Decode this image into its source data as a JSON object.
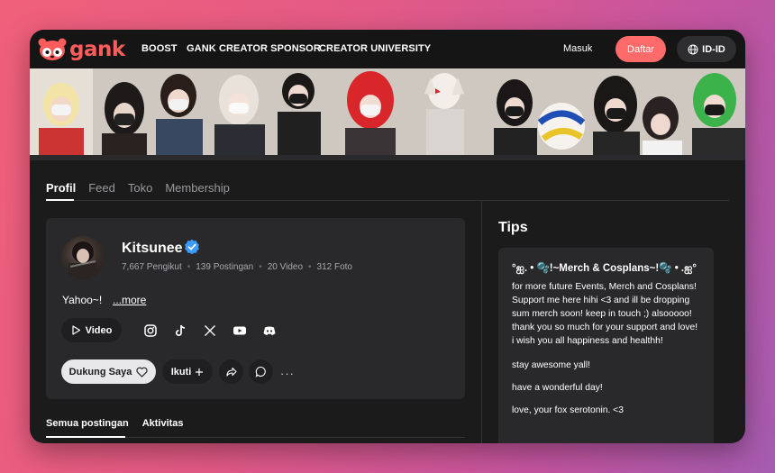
{
  "nav": {
    "logo_text": "gank",
    "links": [
      "BOOST",
      "GANK CREATOR SPONSOR",
      "CREATOR UNIVERSITY"
    ],
    "login_label": "Masuk",
    "signup_label": "Daftar",
    "lang_label": "ID-ID"
  },
  "tabs": [
    {
      "label": "Profil",
      "active": true
    },
    {
      "label": "Feed",
      "active": false
    },
    {
      "label": "Toko",
      "active": false
    },
    {
      "label": "Membership",
      "active": false
    }
  ],
  "profile": {
    "name": "Kitsunee",
    "verified": true,
    "stats": [
      "7,667 Pengikut",
      "139 Postingan",
      "20 Video",
      "312 Foto"
    ],
    "bio": "Yahoo~!",
    "more_label": "...more",
    "video_label": "Video",
    "socials": [
      "instagram-icon",
      "tiktok-icon",
      "x-icon",
      "youtube-icon",
      "discord-icon"
    ],
    "support_label": "Dukung Saya",
    "follow_label": "Ikuti",
    "more_menu": "···"
  },
  "subtabs": [
    {
      "label": "Semua postingan",
      "active": true
    },
    {
      "label": "Aktivitas",
      "active": false
    }
  ],
  "tips": {
    "title": "Tips",
    "heading": "°ஐ. • 🫧!~Merch & Cosplans~!🫧 • .ஐ°",
    "paragraphs": [
      "for more future Events, Merch and Cosplans! Support me here hihi <3 and ill be dropping sum merch soon! keep in touch ;) alsooooo! thank you so much for your support and love! i wish you all happiness and healthh!",
      "stay awesome yall!",
      "have a wonderful day!",
      "love, your fox serotonin. <3"
    ]
  },
  "colors": {
    "accent": "#ff6b6b",
    "background": "#1b1b1c",
    "card": "#29292b",
    "verified": "#3b9cff"
  }
}
